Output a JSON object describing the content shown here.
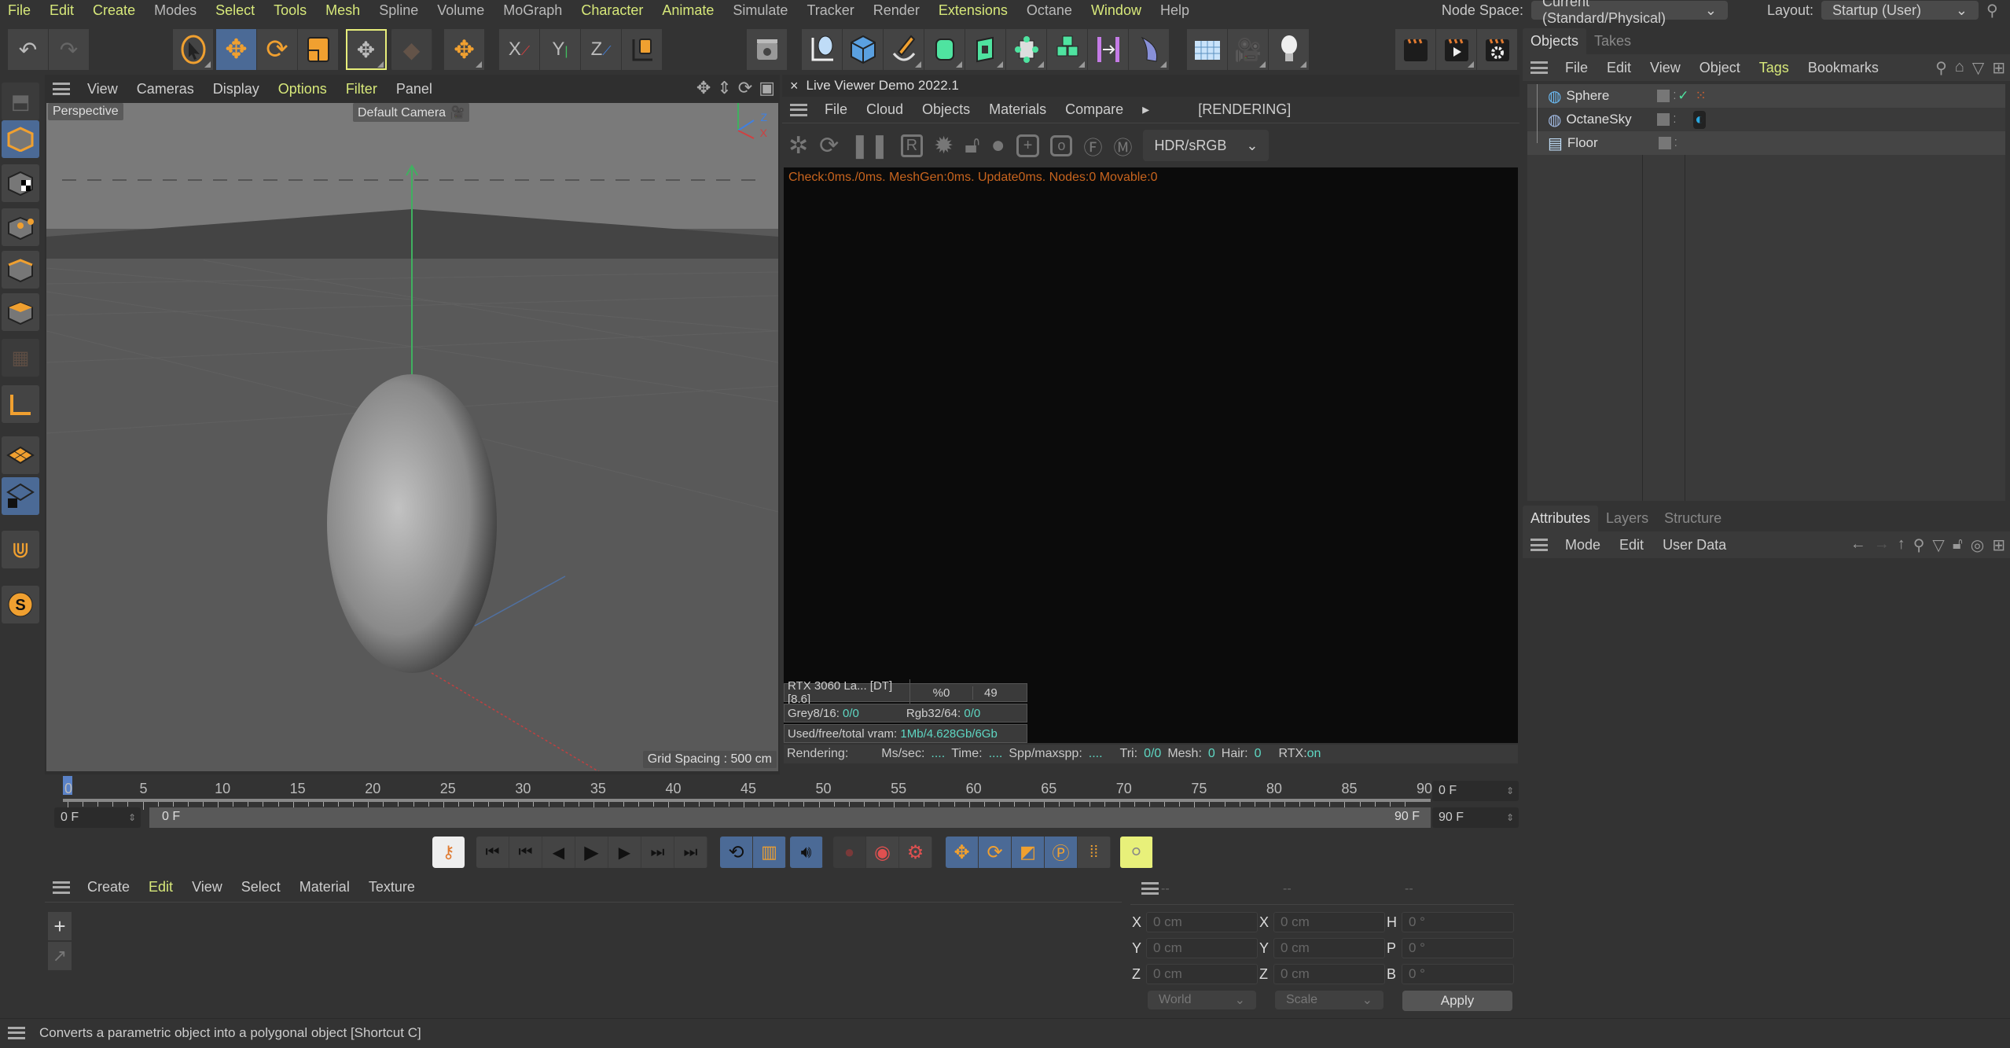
{
  "menubar": {
    "items": [
      {
        "label": "File",
        "hl": true
      },
      {
        "label": "Edit",
        "hl": true
      },
      {
        "label": "Create",
        "hl": true
      },
      {
        "label": "Modes",
        "hl": false
      },
      {
        "label": "Select",
        "hl": true
      },
      {
        "label": "Tools",
        "hl": true
      },
      {
        "label": "Mesh",
        "hl": true
      },
      {
        "label": "Spline",
        "hl": false
      },
      {
        "label": "Volume",
        "hl": false
      },
      {
        "label": "MoGraph",
        "hl": false
      },
      {
        "label": "Character",
        "hl": true
      },
      {
        "label": "Animate",
        "hl": true
      },
      {
        "label": "Simulate",
        "hl": false
      },
      {
        "label": "Tracker",
        "hl": false
      },
      {
        "label": "Render",
        "hl": false
      },
      {
        "label": "Extensions",
        "hl": true
      },
      {
        "label": "Octane",
        "hl": false
      },
      {
        "label": "Window",
        "hl": true
      },
      {
        "label": "Help",
        "hl": false
      }
    ],
    "node_space_label": "Node Space:",
    "node_space_value": "Current (Standard/Physical)",
    "layout_label": "Layout:",
    "layout_value": "Startup (User)"
  },
  "viewport": {
    "menu": [
      {
        "label": "View",
        "hl": false
      },
      {
        "label": "Cameras",
        "hl": false
      },
      {
        "label": "Display",
        "hl": false
      },
      {
        "label": "Options",
        "hl": true
      },
      {
        "label": "Filter",
        "hl": true
      },
      {
        "label": "Panel",
        "hl": false
      }
    ],
    "projection": "Perspective",
    "camera": "Default Camera",
    "grid_spacing": "Grid Spacing : 500 cm",
    "axis_labels": {
      "y": "Y",
      "z": "Z",
      "x": "X"
    }
  },
  "live_viewer": {
    "title": "Live Viewer Demo 2022.1",
    "close": "×",
    "menu": [
      "File",
      "Cloud",
      "Objects",
      "Materials",
      "Compare"
    ],
    "state": "[RENDERING]",
    "color_space": "HDR/sRGB",
    "log": "Check:0ms./0ms. MeshGen:0ms. Update0ms. Nodes:0 Movable:0",
    "gpu": {
      "name": "RTX 3060 La... [DT][8.6]",
      "percent": "%0",
      "value": "49"
    },
    "textures": {
      "grey_label": "Grey8/16:",
      "grey_value": "0/0",
      "rgb_label": "Rgb32/64:",
      "rgb_value": "0/0"
    },
    "vram": {
      "label": "Used/free/total vram:",
      "value": "1Mb/4.628Gb/6Gb"
    },
    "status": {
      "rendering": "Rendering:",
      "ms_label": "Ms/sec:",
      "ms_value": "....",
      "time_label": "Time:",
      "time_value": "....",
      "spp_label": "Spp/maxspp:",
      "spp_value": "....",
      "tri_label": "Tri:",
      "tri_value": "0/0",
      "mesh_label": "Mesh:",
      "mesh_value": "0",
      "hair_label": "Hair:",
      "hair_value": "0",
      "rtx_label": "RTX:",
      "rtx_value": "on"
    }
  },
  "timeline": {
    "ticks": [
      "0",
      "5",
      "10",
      "15",
      "20",
      "25",
      "30",
      "35",
      "40",
      "45",
      "50",
      "55",
      "60",
      "65",
      "70",
      "75",
      "80",
      "85",
      "90"
    ],
    "current_frame": "0 F",
    "start_field": "0 F",
    "range_start": "0 F",
    "range_end": "90 F",
    "end_field": "90 F"
  },
  "material_manager": {
    "menu": [
      {
        "label": "Create",
        "hl": false
      },
      {
        "label": "Edit",
        "hl": true
      },
      {
        "label": "View",
        "hl": false
      },
      {
        "label": "Select",
        "hl": false
      },
      {
        "label": "Material",
        "hl": false
      },
      {
        "label": "Texture",
        "hl": false
      }
    ]
  },
  "coordinates": {
    "headers": [
      "--",
      "--",
      "--"
    ],
    "rows": [
      {
        "pos_label": "X",
        "pos": "0 cm",
        "size_label": "X",
        "size": "0 cm",
        "rot_label": "H",
        "rot": "0 °"
      },
      {
        "pos_label": "Y",
        "pos": "0 cm",
        "size_label": "Y",
        "size": "0 cm",
        "rot_label": "P",
        "rot": "0 °"
      },
      {
        "pos_label": "Z",
        "pos": "0 cm",
        "size_label": "Z",
        "size": "0 cm",
        "rot_label": "B",
        "rot": "0 °"
      }
    ],
    "space": "World",
    "mode": "Scale",
    "apply": "Apply"
  },
  "object_manager": {
    "tabs": [
      {
        "label": "Objects",
        "active": true
      },
      {
        "label": "Takes",
        "active": false
      }
    ],
    "menu": [
      {
        "label": "File",
        "hl": false
      },
      {
        "label": "Edit",
        "hl": false
      },
      {
        "label": "View",
        "hl": false
      },
      {
        "label": "Object",
        "hl": false
      },
      {
        "label": "Tags",
        "hl": true
      },
      {
        "label": "Bookmarks",
        "hl": false
      }
    ],
    "objects": [
      {
        "name": "Sphere",
        "icon": "sphere-icon",
        "check": true,
        "tag": "material-tag-icon"
      },
      {
        "name": "OctaneSky",
        "icon": "sky-icon",
        "check": false,
        "tag": "octane-environment-tag-icon"
      },
      {
        "name": "Floor",
        "icon": "floor-icon",
        "check": false,
        "tag": ""
      }
    ]
  },
  "attributes": {
    "tabs": [
      {
        "label": "Attributes",
        "active": true
      },
      {
        "label": "Layers",
        "active": false
      },
      {
        "label": "Structure",
        "active": false
      }
    ],
    "menu": [
      "Mode",
      "Edit",
      "User Data"
    ]
  },
  "statusbar": {
    "text": "Converts a parametric object into a polygonal object [Shortcut C]"
  },
  "colors": {
    "highlight_menu": "#d7e87a",
    "accent_orange": "#f0a030",
    "selected_blue": "#4b6a96",
    "log_orange": "#c8641e",
    "stat_cyan": "#5ed7c3"
  }
}
